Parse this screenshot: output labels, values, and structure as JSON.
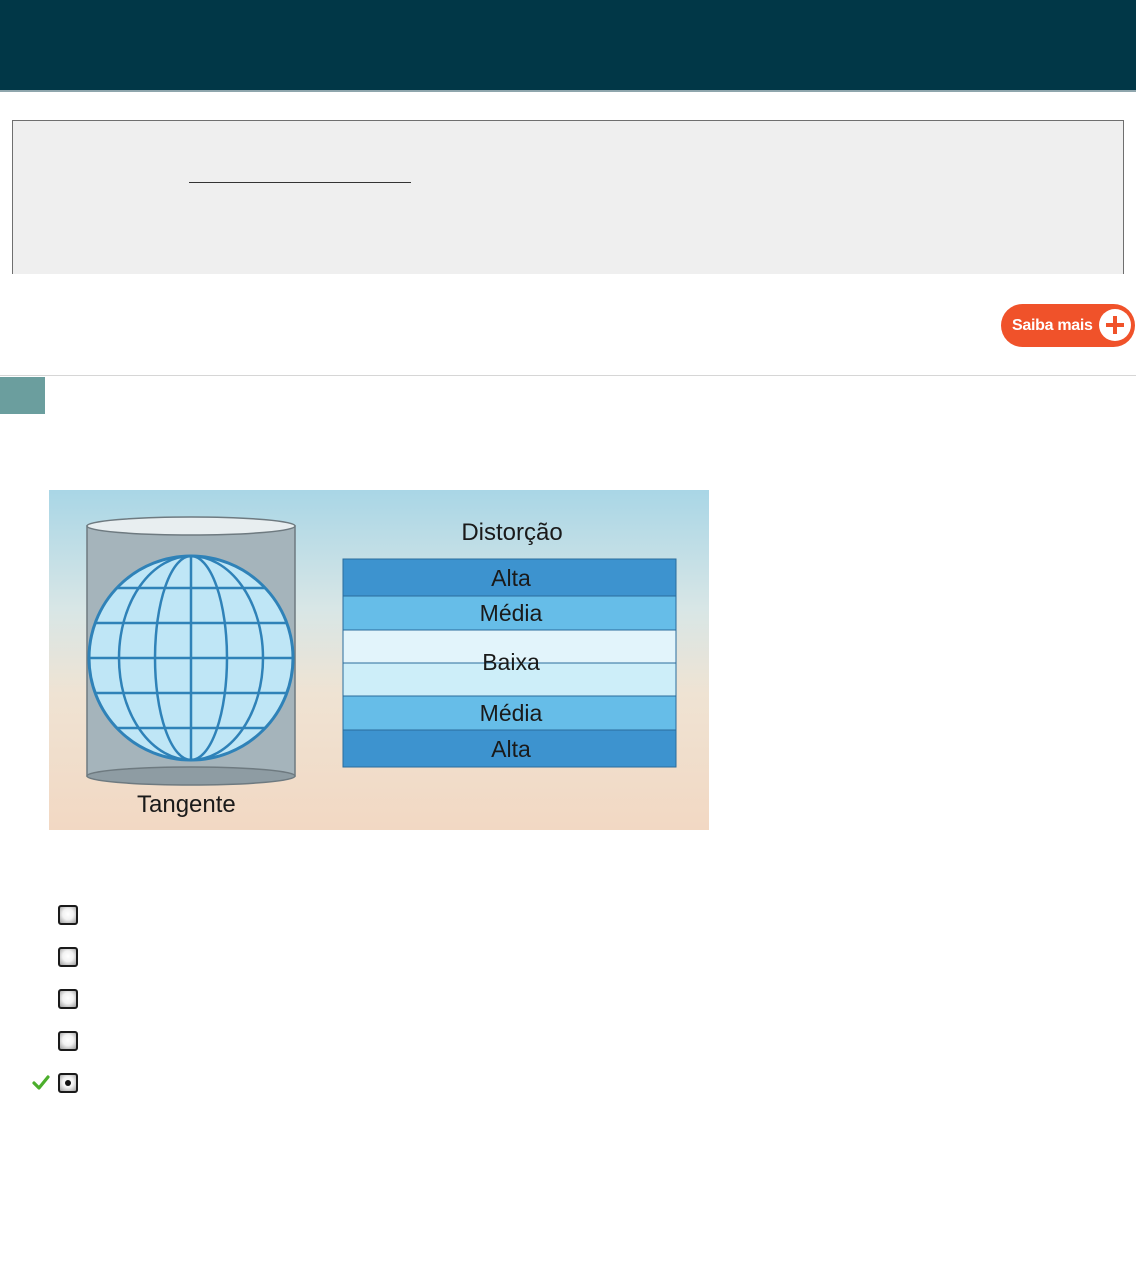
{
  "saiba_button": {
    "label": "Saiba mais",
    "icon": "plus-circle-icon",
    "color": "#f0522a"
  },
  "colors": {
    "header": "#013747",
    "panel": "#efefef",
    "question_marker": "#6b9e9e"
  },
  "figure": {
    "title": "Distorção",
    "bands": [
      "Alta",
      "Média",
      "Baixa",
      "Média",
      "Alta"
    ],
    "caption": "Tangente"
  },
  "options": [
    {
      "selected": false,
      "correct": false
    },
    {
      "selected": false,
      "correct": false
    },
    {
      "selected": false,
      "correct": false
    },
    {
      "selected": false,
      "correct": false
    },
    {
      "selected": true,
      "correct": true,
      "mark_icon": "check-icon"
    }
  ]
}
